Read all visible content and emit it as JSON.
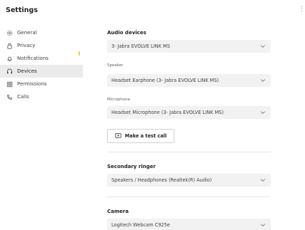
{
  "header": {
    "title": "Settings",
    "more_glyph": "⋮"
  },
  "sidebar": {
    "items": [
      {
        "label": "General",
        "icon": "gear-icon",
        "active": false
      },
      {
        "label": "Privacy",
        "icon": "lock-icon",
        "active": false
      },
      {
        "label": "Notifications",
        "icon": "bell-icon",
        "active": false
      },
      {
        "label": "Devices",
        "icon": "devices-icon",
        "active": true
      },
      {
        "label": "Permissions",
        "icon": "grid-icon",
        "active": false
      },
      {
        "label": "Calls",
        "icon": "phone-icon",
        "active": false
      }
    ]
  },
  "devices": {
    "audio_title": "Audio devices",
    "audio_device": "3- Jabra EVOLVE LINK MS",
    "speaker_label": "Speaker",
    "speaker_value": "Headset Earphone (3- Jabra EVOLVE LINK MS)",
    "microphone_label": "Microphone",
    "microphone_value": "Headset Microphone (3- Jabra EVOLVE LINK MS)",
    "test_call_label": "Make a test call",
    "secondary_title": "Secondary ringer",
    "secondary_value": "Speakers / Headphones (Realtek(R) Audio)",
    "camera_title": "Camera",
    "camera_value": "Logitech Webcam C925e"
  },
  "colors": {
    "active_nav_bg": "#ebebeb",
    "dropdown_bg": "#f2f2f2",
    "accent_mark": "#f5d33c"
  }
}
